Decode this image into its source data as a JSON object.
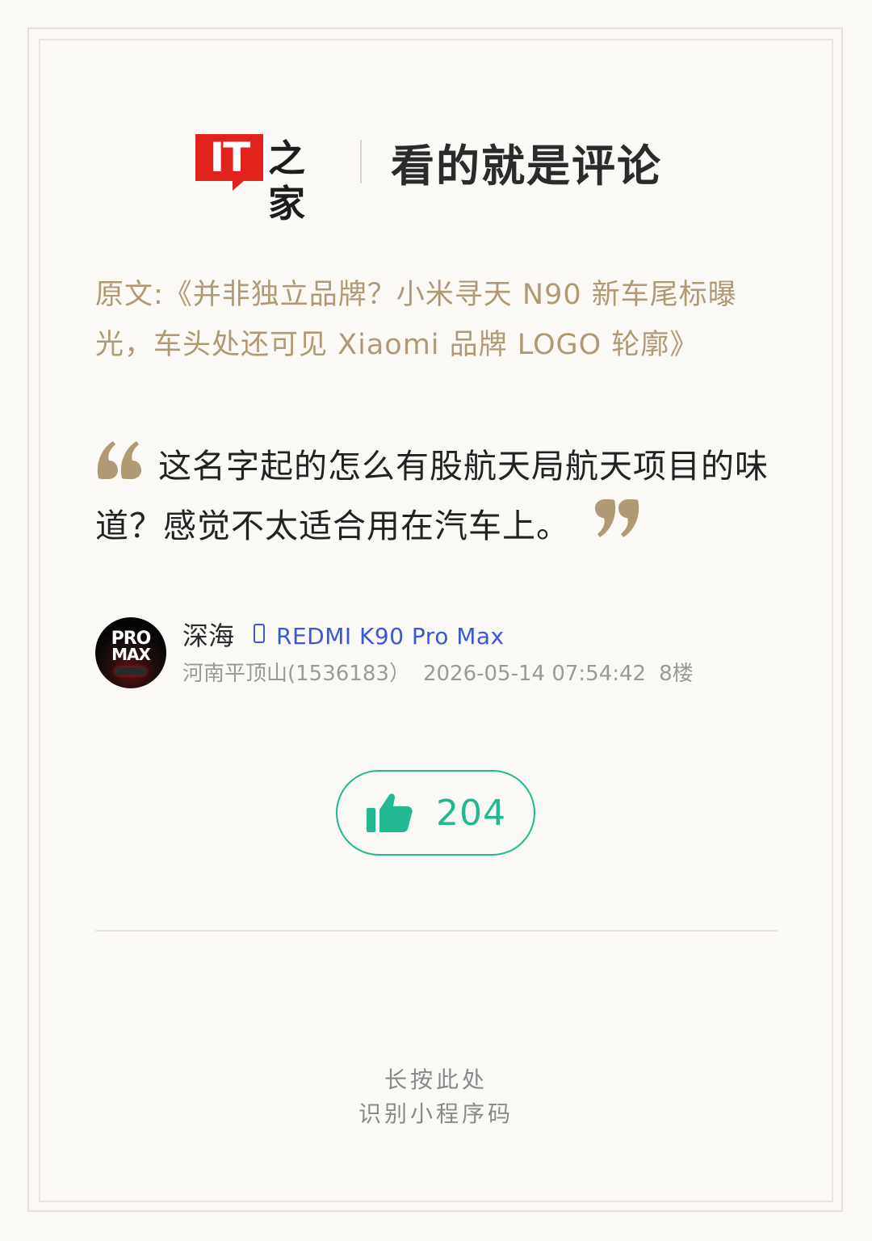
{
  "header": {
    "logo_it": "IT",
    "logo_cn": "之家",
    "title": "看的就是评论"
  },
  "source": {
    "text": "原文:《并非独立品牌？小米寻天 N90 新车尾标曝光，车头处还可见 Xiaomi 品牌 LOGO 轮廓》"
  },
  "comment": {
    "text": "这名字起的怎么有股航天局航天项目的味道？感觉不太适合用在汽车上。"
  },
  "user": {
    "avatar_line1": "PRO",
    "avatar_line2": "MAX",
    "name": "深海",
    "device": "REDMI K90 Pro Max",
    "location": "河南平顶山(1536183）",
    "datetime": "2026-05-14 07:54:42",
    "floor": "8楼"
  },
  "like": {
    "count": "204"
  },
  "footer": {
    "line1": "长按此处",
    "line2": "识别小程序码"
  },
  "colors": {
    "brand_red": "#e1221d",
    "quote_gold": "#b09a75",
    "device_blue": "#3b57d6",
    "like_green": "#22b891"
  },
  "icons": {
    "quote_open": "quote-open-icon",
    "quote_close": "quote-close-icon",
    "phone": "phone-icon",
    "thumb": "thumbs-up-icon"
  }
}
